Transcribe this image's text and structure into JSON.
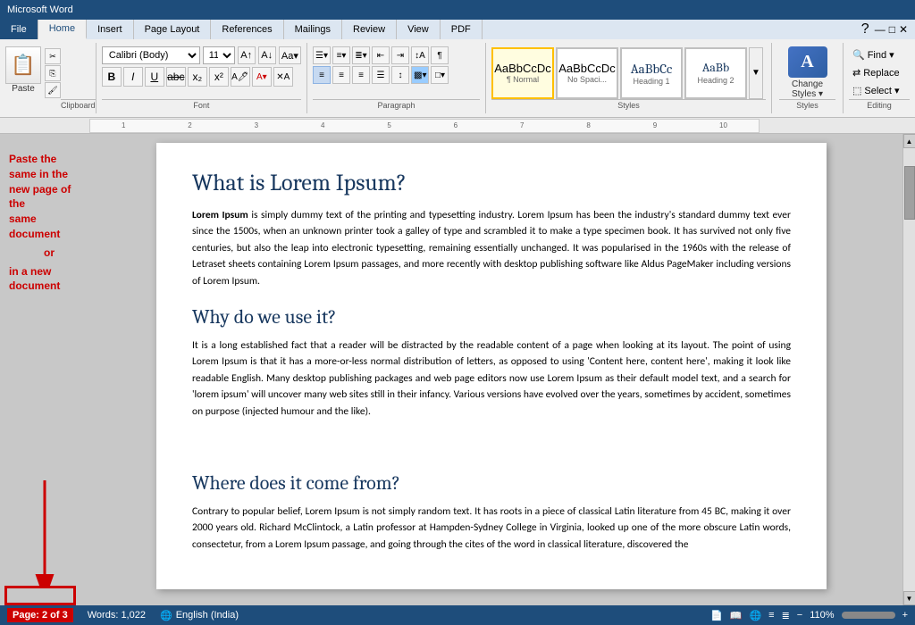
{
  "titlebar": {
    "text": "Microsoft Word"
  },
  "tabs": {
    "items": [
      "File",
      "Home",
      "Insert",
      "Page Layout",
      "References",
      "Mailings",
      "Review",
      "View",
      "PDF"
    ],
    "active": "Home"
  },
  "ribbon": {
    "clipboard": {
      "label": "Clipboard",
      "paste_label": "Paste"
    },
    "font": {
      "label": "Font",
      "font_name": "Calibri (Body)",
      "font_size": "11",
      "bold": "B",
      "italic": "I",
      "underline": "U",
      "strikethrough": "abc",
      "subscript": "x₂",
      "superscript": "x²"
    },
    "paragraph": {
      "label": "Paragraph",
      "align_left": "≡",
      "align_center": "≡",
      "align_right": "≡",
      "justify": "≡"
    },
    "styles": {
      "label": "Styles",
      "items": [
        {
          "name": "¶ Normal",
          "label": "Normal",
          "active": true
        },
        {
          "name": "AaBbCcDc",
          "label": "No Spaci...",
          "active": false
        },
        {
          "name": "AaBbCc",
          "label": "Heading 1",
          "active": false
        },
        {
          "name": "AaBb",
          "label": "Heading 2",
          "active": false
        }
      ]
    },
    "change_styles": {
      "label": "Change\nStyles ▾",
      "icon": "A"
    },
    "editing": {
      "label": "Editing",
      "find": "Find ▾",
      "replace": "Replace",
      "select": "Select ▾"
    }
  },
  "annotation": {
    "line1": "Paste the",
    "line2": "same in the",
    "line3": "new page of the",
    "line4": "same document",
    "or": "or",
    "line5": "in a new",
    "line6": "document"
  },
  "document": {
    "h1": "What is Lorem Ipsum?",
    "p1_bold": "Lorem Ipsum",
    "p1": " is simply dummy text of the printing and typesetting industry. Lorem Ipsum has been the industry's standard dummy text ever since the 1500s, when an unknown printer took a galley of type and scrambled it to make a type specimen book. It has survived not only five centuries, but also the leap into electronic typesetting, remaining essentially unchanged. It was popularised in the 1960s with the release of Letraset sheets containing Lorem Ipsum passages, and more recently with desktop publishing software like Aldus PageMaker including versions of Lorem Ipsum.",
    "h2": "Why do we use it?",
    "p2": "It is a long established fact that a reader will be distracted by the readable content of a page when looking at its layout. The point of using Lorem Ipsum is that it has a more-or-less normal distribution of letters, as opposed to using 'Content here, content here', making it look like readable English. Many desktop publishing packages and web page editors now use Lorem Ipsum as their default model text, and a search for 'lorem ipsum' will uncover many web sites still in their infancy. Various versions have evolved over the years, sometimes by accident, sometimes on purpose (injected humour and the like).",
    "h3": "Where does it come from?",
    "p3": "Contrary to popular belief, Lorem Ipsum is not simply random text. It has roots in a piece of classical Latin literature from 45 BC, making it over 2000 years old. Richard McClintock, a Latin professor at Hampden-Sydney College in Virginia, looked up one of the more obscure Latin words, consectetur, from a Lorem Ipsum passage, and going through the cites of the word in classical literature, discovered the"
  },
  "statusbar": {
    "page": "Page: 2 of 3",
    "words": "Words: 1,022",
    "language": "English (India)",
    "zoom": "110%"
  }
}
